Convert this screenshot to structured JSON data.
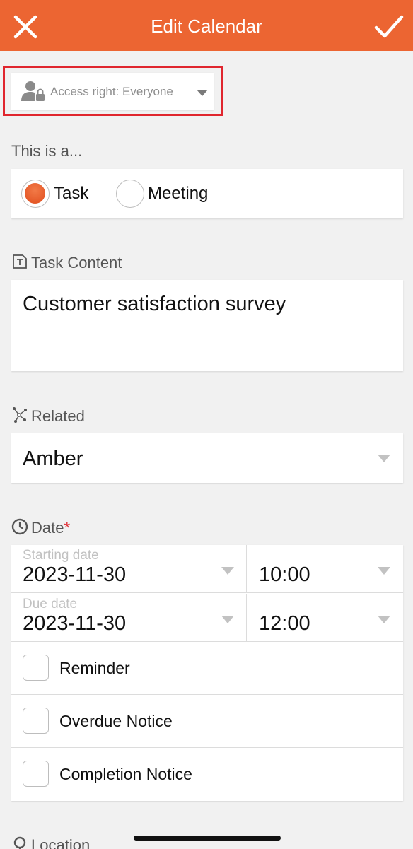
{
  "header": {
    "title": "Edit Calendar",
    "close_icon": "close-icon",
    "save_icon": "check-icon",
    "color": "#ec6532"
  },
  "access": {
    "label": "Access right: Everyone",
    "icon": "user-lock-icon"
  },
  "type": {
    "label": "This is a...",
    "options": [
      {
        "label": "Task",
        "selected": true
      },
      {
        "label": "Meeting",
        "selected": false
      }
    ]
  },
  "task_content": {
    "label": "Task Content",
    "value": "Customer satisfaction survey"
  },
  "related": {
    "label": "Related",
    "value": "Amber"
  },
  "date": {
    "label": "Date",
    "required_mark": "*",
    "starting": {
      "label": "Starting date",
      "date": "2023-11-30",
      "time": "10:00"
    },
    "due": {
      "label": "Due date",
      "date": "2023-11-30",
      "time": "12:00"
    }
  },
  "notices": [
    {
      "label": "Reminder"
    },
    {
      "label": "Overdue Notice"
    },
    {
      "label": "Completion Notice"
    }
  ],
  "location": {
    "label": "Location"
  }
}
